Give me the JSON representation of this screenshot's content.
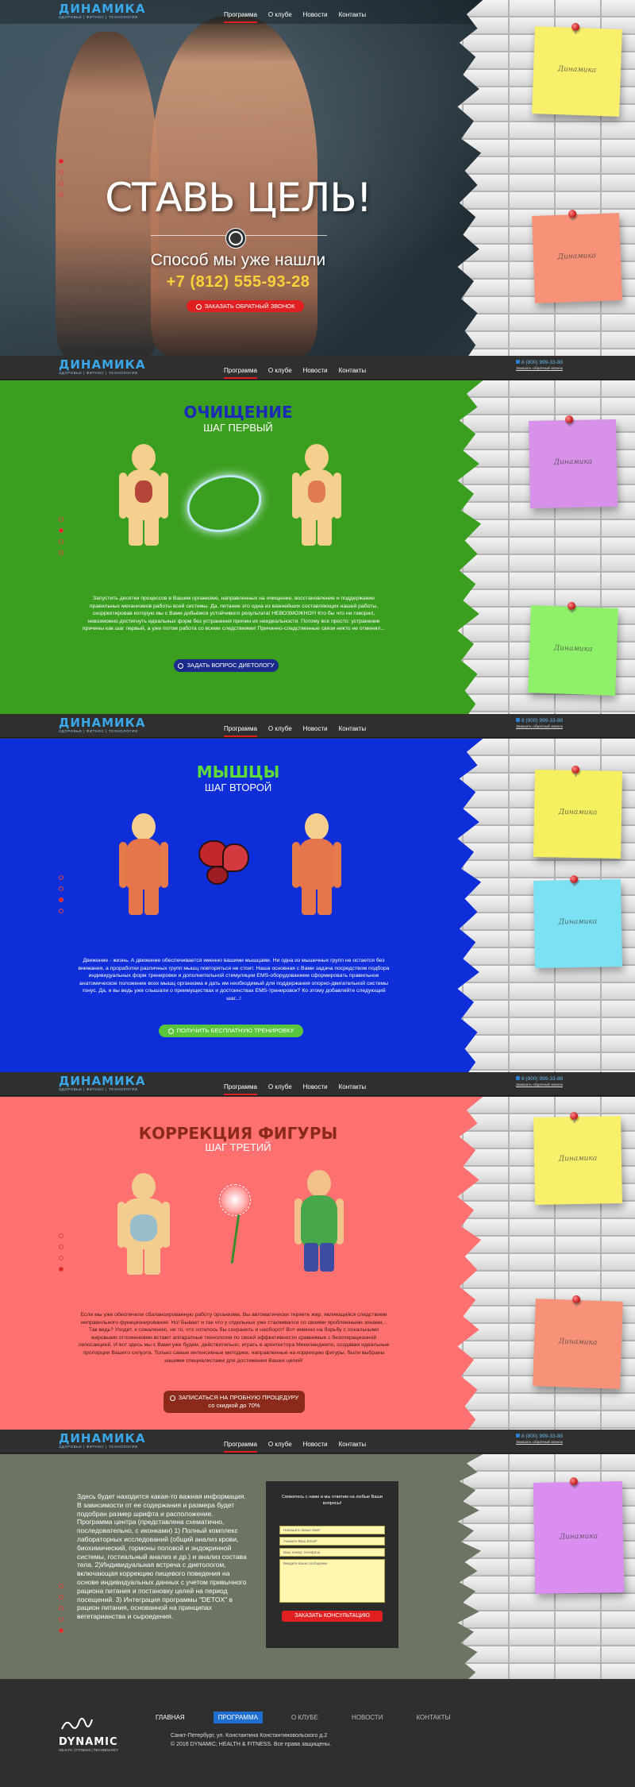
{
  "nav": {
    "logo": "ДИНАМИКА",
    "logo_sub": "ЗДОРОВЬЕ | ФИТНЕС | ТЕХНОЛОГИИ",
    "items": [
      "Программа",
      "О клубе",
      "Новости",
      "Контакты"
    ],
    "phone": "8 (800) 999-33-88",
    "callback": "Заказать обратный звонок"
  },
  "hero": {
    "title": "СТАВЬ ЦЕЛЬ!",
    "subtitle": "Способ мы уже нашли",
    "phone": "+7 (812) 555-93-28",
    "button": "ЗАКАЗАТЬ ОБРАТНЫЙ ЗВОНОК"
  },
  "notes": {
    "label": "Динамика"
  },
  "step1": {
    "title": "ОЧИЩЕНИЕ",
    "subtitle": "ШАГ ПЕРВЫЙ",
    "text": "Запустить десятки процессов в Вашем организме, направленных на очищение, восстановление и поддержание правильных механизмов работы всей системы. Да, питание это одна из важнейших составляющих нашей работы, скорректировав которую мы с Вами добьёмся устойчивого результата! НЕВОЗМОЖНО!!! Кто бы что ни говорил, невозможно достигнуть идеальных форм без устранения причин их неидеальности. Потому все просто: устранение причины как шаг первый, а уже потом работа со всеми следствиями! Причинно-следственные связи никто не отменял...",
    "button": "ЗАДАТЬ ВОПРОС ДИЕТОЛОГУ"
  },
  "step2": {
    "title": "МЫШЦЫ",
    "subtitle": "ШАГ ВТОРОЙ",
    "text": "Движение - жизнь. А движение обеспечивается именно вашими мышцами. Ни одна из мышечных групп не остается без внимания, а проработки различных групп мышц повторяться не стоит. Наша основная с Вами задача посредством подбора индивидуальных форм тренировки и дополнительной стимуляции EMS-оборудованием сформировать правильное анатомическое положение всех мышц организма и дать им необходимый для поддержания опорно-двигательной системы тонус. Да, и вы ведь уже слышали о преимуществах и достоинствах EMS-тренировок? Ко этому добавляйте следующий шаг...!",
    "button": "ПОЛУЧИТЬ БЕСПЛАТНУЮ ТРЕНИРОВКУ"
  },
  "step3": {
    "title": "КОРРЕКЦИЯ ФИГУРЫ",
    "subtitle": "ШАГ ТРЕТИЙ",
    "text": "Если мы уже обеспечили сбалансированную работу организма, Вы автоматически теряете жир, являющийся следствием неправильного функционирования. Но! Бывает и так что у отдельных уже сталкивался со своими проблемными зонами... Так ведь? Уходит, к сожалению, не то, что хотелось бы сохранить и наоборот! Вот именно на борьбу с локальными жировыми отложениями встают аппаратные технологии по своей эффективности сравнимые с безоперационной липосакцией. И вот здесь мы с Вами уже будем, действительно, играть в архитектора Микеланджело, создавая идеальные пропорции Вашего силуэта. Только самые интенсивные методики, направленные на коррекцию фигуры, были выбраны нашими специалистами для достижения Ваших целей!",
    "button": "ЗАПИСАТЬСЯ НА ПРОБНУЮ ПРОЦЕДУРУ",
    "button_sub": "со скидкой до 70%"
  },
  "contact": {
    "text": "Здесь будет находится какая-то важная информация. В зависимости от ее содержания и размера будет подобран размер шрифта и расположение. Программа центра (представлена схематично, последовательно, с иконками) 1) Полный комплекс лабораторных исследований (общий анализ крови, биохимический, гормоны половой и эндокринной системы, гостиальный анализ и др.) и анализ состава тела. 2)Индивидуальная встреча с диетологом, включающая коррекцию пищевого поведения на основе индивидуальных данных с учетом привычного рациона питания и постановку целей на период посещений. 3) Интеграция программы \"DETOX\" в рацион питания, основанной на принципах вегетарианства и сыроедения.",
    "form_title": "Свяжитесь с нами и мы ответим на любые Ваши вопросы!",
    "name_ph": "Напишите Ваше Имя*",
    "email_ph": "Укажите Ваш Email*",
    "phone_ph": "Ваш номер телефона",
    "message_ph": "Введите ваше сообщение",
    "submit": "ЗАКАЗАТЬ КОНСУЛЬТАЦИЮ"
  },
  "footer": {
    "links": [
      "ГЛАВНАЯ",
      "ПРОГРАММА",
      "О КЛУБЕ",
      "НОВОСТИ",
      "КОНТАКТЫ"
    ],
    "logo": "DYNAMIC",
    "logo_sub": "HEALTH | FITNESS | TECHNOLOGY",
    "address": "Санкт-Петербург, ул. Константина Константиновольского д.2",
    "copyright": "© 2016 DYNAMIC; HEALTH & FITNESS. Все права защищены."
  },
  "colors": {
    "green": "#3a9e1e",
    "blue": "#0d2ed8",
    "coral": "#ff7070",
    "olive": "#6c7563",
    "yellow": "#f8ef6a",
    "salmon": "#f79279",
    "purple": "#d791e8",
    "lime": "#8ff06a",
    "cyan": "#7ce1f2",
    "pink": "#d98ef0"
  }
}
